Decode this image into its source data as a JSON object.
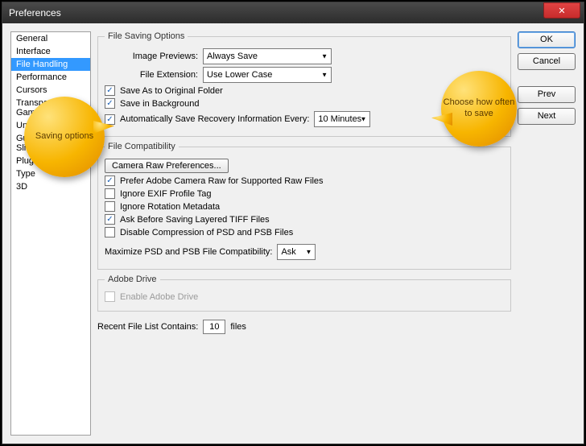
{
  "window": {
    "title": "Preferences"
  },
  "sidebar": {
    "items": [
      "General",
      "Interface",
      "File Handling",
      "Performance",
      "Cursors",
      "Transparency & Gamut",
      "Units & Rulers",
      "Guides, Grid & Slices",
      "Plug-Ins",
      "Type",
      "3D"
    ],
    "selected_index": 2
  },
  "buttons": {
    "ok": "OK",
    "cancel": "Cancel",
    "prev": "Prev",
    "next": "Next"
  },
  "saving": {
    "legend": "File Saving Options",
    "img_previews_label": "Image Previews:",
    "img_previews_value": "Always Save",
    "file_ext_label": "File Extension:",
    "file_ext_value": "Use Lower Case",
    "save_original": "Save As to Original Folder",
    "save_bg": "Save in Background",
    "auto_save": "Automatically Save Recovery Information Every:",
    "auto_save_value": "10 Minutes"
  },
  "compat": {
    "legend": "File Compatibility",
    "camera_raw_btn": "Camera Raw Preferences...",
    "prefer_acr": "Prefer Adobe Camera Raw for Supported Raw Files",
    "ignore_exif": "Ignore EXIF Profile Tag",
    "ignore_rot": "Ignore Rotation Metadata",
    "ask_tiff": "Ask Before Saving Layered TIFF Files",
    "disable_comp": "Disable Compression of PSD and PSB Files",
    "max_label": "Maximize PSD and PSB File Compatibility:",
    "max_value": "Ask"
  },
  "drive": {
    "legend": "Adobe Drive",
    "enable": "Enable Adobe Drive"
  },
  "recent": {
    "label_pre": "Recent File List Contains:",
    "value": "10",
    "label_post": "files"
  },
  "callouts": {
    "c1": "Saving options",
    "c2": "Choose how often to save"
  }
}
